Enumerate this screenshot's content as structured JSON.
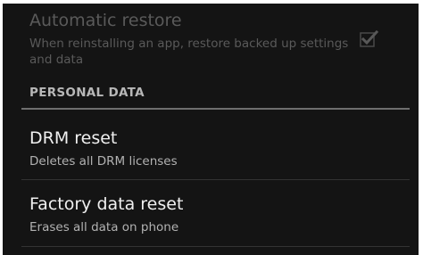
{
  "backup": {
    "automatic_restore": {
      "title": "Automatic restore",
      "summary": "When reinstalling an app, restore backed up settings and data",
      "checked": true,
      "enabled": false
    }
  },
  "personal_data": {
    "header": "PERSONAL DATA",
    "items": [
      {
        "title": "DRM reset",
        "summary": "Deletes all DRM licenses"
      },
      {
        "title": "Factory data reset",
        "summary": "Erases all data on phone"
      }
    ]
  },
  "icons": {
    "checkbox": "checkbox-checked-icon"
  },
  "colors": {
    "background": "#141414",
    "disabled_text": "#5a5a5a",
    "primary_text": "#f0f0f0",
    "secondary_text": "#b2b2b2",
    "header_text": "#b8b8b8"
  }
}
